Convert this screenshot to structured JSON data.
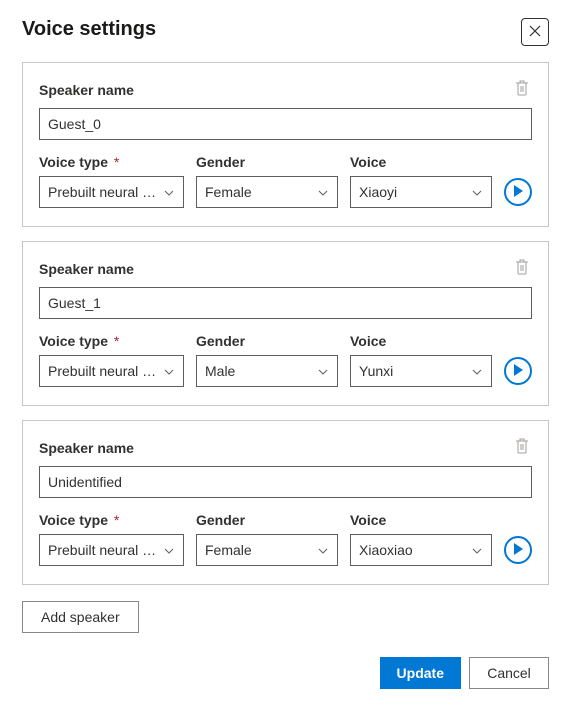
{
  "dialog": {
    "title": "Voice settings"
  },
  "labels": {
    "speaker_name": "Speaker name",
    "voice_type": "Voice type",
    "gender": "Gender",
    "voice": "Voice",
    "required_mark": "*"
  },
  "speakers": [
    {
      "name": "Guest_0",
      "voice_type": "Prebuilt neural voice",
      "gender": "Female",
      "voice": "Xiaoyi"
    },
    {
      "name": "Guest_1",
      "voice_type": "Prebuilt neural voice",
      "gender": "Male",
      "voice": "Yunxi"
    },
    {
      "name": "Unidentified",
      "voice_type": "Prebuilt neural voice",
      "gender": "Female",
      "voice": "Xiaoxiao"
    }
  ],
  "buttons": {
    "add_speaker": "Add speaker",
    "update": "Update",
    "cancel": "Cancel"
  }
}
